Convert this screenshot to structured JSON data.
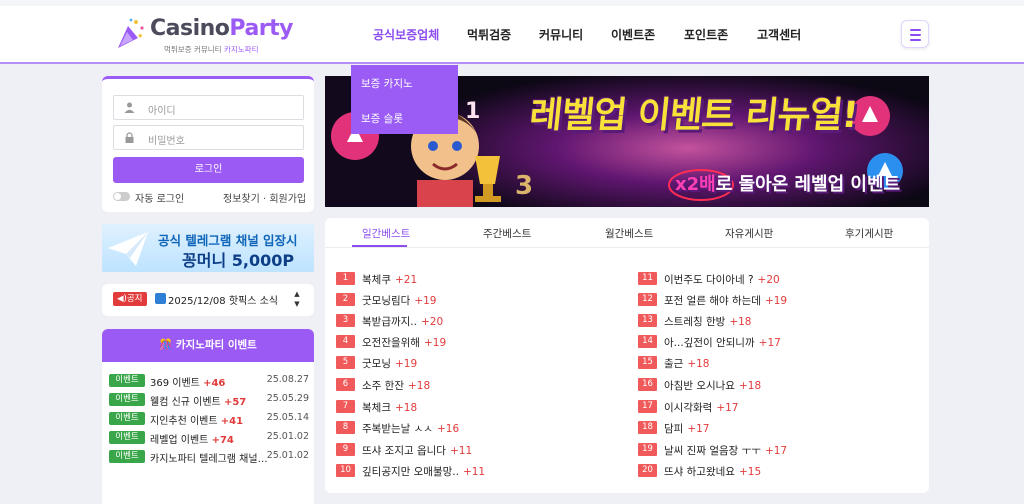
{
  "header": {
    "logo": {
      "part1": "Casino",
      "part2": "Party",
      "sub1": "먹튀보증 커뮤니티",
      "sub2": "카지노파티"
    },
    "nav": [
      "공식보증업체",
      "먹튀검증",
      "커뮤니티",
      "이벤트존",
      "포인트존",
      "고객센터"
    ],
    "active_nav": "공식보증업체",
    "dropdown": [
      "보증 카지노",
      "보증 슬롯"
    ]
  },
  "login": {
    "id_placeholder": "아이디",
    "pw_placeholder": "비밀번호",
    "login_label": "로그인",
    "auto_login_label": "자동 로그인",
    "find_links": "정보찾기 · 회원가입"
  },
  "telegram": {
    "line1": "공식 텔레그램 채널 입장시",
    "line2": "꽁머니 5,000P"
  },
  "notice": {
    "badge": "◀)공지",
    "text": "2025/12/08 핫픽스 소식",
    "up": "▲",
    "down": "▼"
  },
  "events": {
    "title": "🎊 카지노파티 이벤트",
    "items": [
      {
        "badge": "이벤트",
        "title": "369 이벤트",
        "plus": "+46",
        "date": "25.08.27"
      },
      {
        "badge": "이벤트",
        "title": "웰컴 신규 이벤트",
        "plus": "+57",
        "date": "25.05.29"
      },
      {
        "badge": "이벤트",
        "title": "지인추천 이벤트",
        "plus": "+41",
        "date": "25.05.14"
      },
      {
        "badge": "이벤트",
        "title": "레벨업 이벤트",
        "plus": "+74",
        "date": "25.01.02"
      },
      {
        "badge": "이벤트",
        "title": "카지노파티 텔레그램 채널 …",
        "plus": "",
        "date": "25.01.02"
      }
    ]
  },
  "banner": {
    "title": "레벨업 이벤트 리뉴얼!",
    "x2": "x2배",
    "sub": "로 돌아온 레벨업 이벤트"
  },
  "boards": {
    "tabs": [
      "일간베스트",
      "주간베스트",
      "월간베스트",
      "자유게시판",
      "후기게시판"
    ],
    "active_tab": "일간베스트",
    "left": [
      {
        "rank": "1",
        "title": "복체쿠",
        "count": "+21"
      },
      {
        "rank": "2",
        "title": "굿모닝림다",
        "count": "+19"
      },
      {
        "rank": "3",
        "title": "복받급까지..",
        "count": "+20"
      },
      {
        "rank": "4",
        "title": "오전잔을위해",
        "count": "+19"
      },
      {
        "rank": "5",
        "title": "굿모닝",
        "count": "+19"
      },
      {
        "rank": "6",
        "title": "소주 한잔",
        "count": "+18"
      },
      {
        "rank": "7",
        "title": "복체크",
        "count": "+18"
      },
      {
        "rank": "8",
        "title": "주복받는날 ㅅㅅ",
        "count": "+16"
      },
      {
        "rank": "9",
        "title": "뜨샤 조지고 옵니다",
        "count": "+11"
      },
      {
        "rank": "10",
        "title": "깊티공지만 오매불망..",
        "count": "+11"
      }
    ],
    "right": [
      {
        "rank": "11",
        "title": "이번주도 다이아네 ?",
        "count": "+20"
      },
      {
        "rank": "12",
        "title": "포전 얼른 해야 하는데",
        "count": "+19"
      },
      {
        "rank": "13",
        "title": "스트레칭 한방",
        "count": "+18"
      },
      {
        "rank": "14",
        "title": "아...깊전이 안되니까",
        "count": "+17"
      },
      {
        "rank": "15",
        "title": "출근",
        "count": "+18"
      },
      {
        "rank": "16",
        "title": "아침반 오시나요",
        "count": "+18"
      },
      {
        "rank": "17",
        "title": "이시각화력",
        "count": "+17"
      },
      {
        "rank": "18",
        "title": "담피",
        "count": "+17"
      },
      {
        "rank": "19",
        "title": "날씨 진짜 얼음장 ㅜㅜ",
        "count": "+17"
      },
      {
        "rank": "20",
        "title": "뜨샤 하고왔네요",
        "count": "+15"
      }
    ]
  },
  "colors": {
    "accent": "#9c5af5",
    "rank": "#f05a5a",
    "event_badge": "#3aa64a",
    "notice": "#e23b3b"
  }
}
